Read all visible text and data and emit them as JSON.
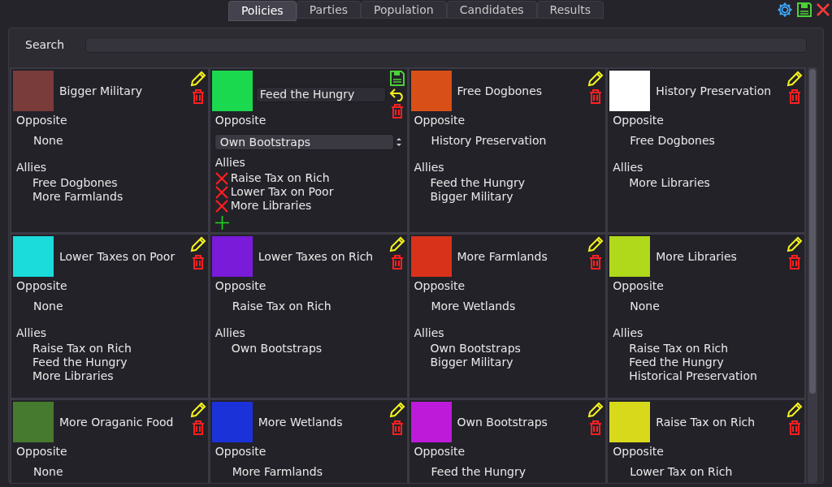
{
  "tabs": [
    {
      "label": "Policies",
      "selected": true
    },
    {
      "label": "Parties",
      "selected": false
    },
    {
      "label": "Population",
      "selected": false
    },
    {
      "label": "Candidates",
      "selected": false
    },
    {
      "label": "Results",
      "selected": false
    }
  ],
  "search": {
    "label": "Search"
  },
  "policies": [
    {
      "kind": "view",
      "name": "Bigger Military",
      "color": "#7a3b3b",
      "opposite_label": "Opposite",
      "opposite": "None",
      "allies_label": "Allies",
      "allies": [
        "Free Dogbones",
        "More Farmlands"
      ]
    },
    {
      "kind": "editing",
      "name": "Feed the Hungry",
      "color": "#1bd94f",
      "opposite_label": "Opposite",
      "opposite": "Own Bootstraps",
      "allies_label": "Allies",
      "allies": [
        "Raise Tax on Rich",
        "Lower Tax on Poor",
        "More Libraries"
      ]
    },
    {
      "kind": "view",
      "name": "Free Dogbones",
      "color": "#d94f18",
      "opposite_label": "Opposite",
      "opposite": "History Preservation",
      "allies_label": "Allies",
      "allies": [
        "Feed the Hungry",
        "Bigger Military"
      ]
    },
    {
      "kind": "view",
      "name": "History Preservation",
      "color": "#ffffff",
      "opposite_label": "Opposite",
      "opposite": "Free Dogbones",
      "allies_label": "Allies",
      "allies": [
        "More Libraries"
      ]
    },
    {
      "kind": "view",
      "name": "Lower Taxes on Poor",
      "color": "#1bdbdb",
      "opposite_label": "Opposite",
      "opposite": "None",
      "allies_label": "Allies",
      "allies": [
        "Raise Tax on Rich",
        "Feed the Hungry",
        "More Libraries"
      ]
    },
    {
      "kind": "view",
      "name": "Lower Taxes on Rich",
      "color": "#7a1bd9",
      "opposite_label": "Opposite",
      "opposite": "Raise Tax on Rich",
      "allies_label": "Allies",
      "allies": [
        "Own Bootstraps"
      ]
    },
    {
      "kind": "view",
      "name": "More Farmlands",
      "color": "#d9321b",
      "opposite_label": "Opposite",
      "opposite": "More Wetlands",
      "allies_label": "Allies",
      "allies": [
        "Own Bootstraps",
        "Bigger Military"
      ]
    },
    {
      "kind": "view",
      "name": "More Libraries",
      "color": "#b0d91b",
      "opposite_label": "Opposite",
      "opposite": "None",
      "allies_label": "Allies",
      "allies": [
        "Raise Tax on Rich",
        "Feed the Hungry",
        "Historical Preservation"
      ]
    },
    {
      "kind": "view",
      "name": "More Oraganic Food",
      "color": "#467a2e",
      "opposite_label": "Opposite",
      "opposite": "None"
    },
    {
      "kind": "view",
      "name": "More Wetlands",
      "color": "#1b32d9",
      "opposite_label": "Opposite",
      "opposite": "More Farmlands"
    },
    {
      "kind": "view",
      "name": "Own Bootstraps",
      "color": "#bd1bd9",
      "opposite_label": "Opposite",
      "opposite": "Feed the Hungry"
    },
    {
      "kind": "view",
      "name": "Raise Tax on Rich",
      "color": "#d9d91b",
      "opposite_label": "Opposite",
      "opposite": "Lower Tax on Rich"
    }
  ]
}
